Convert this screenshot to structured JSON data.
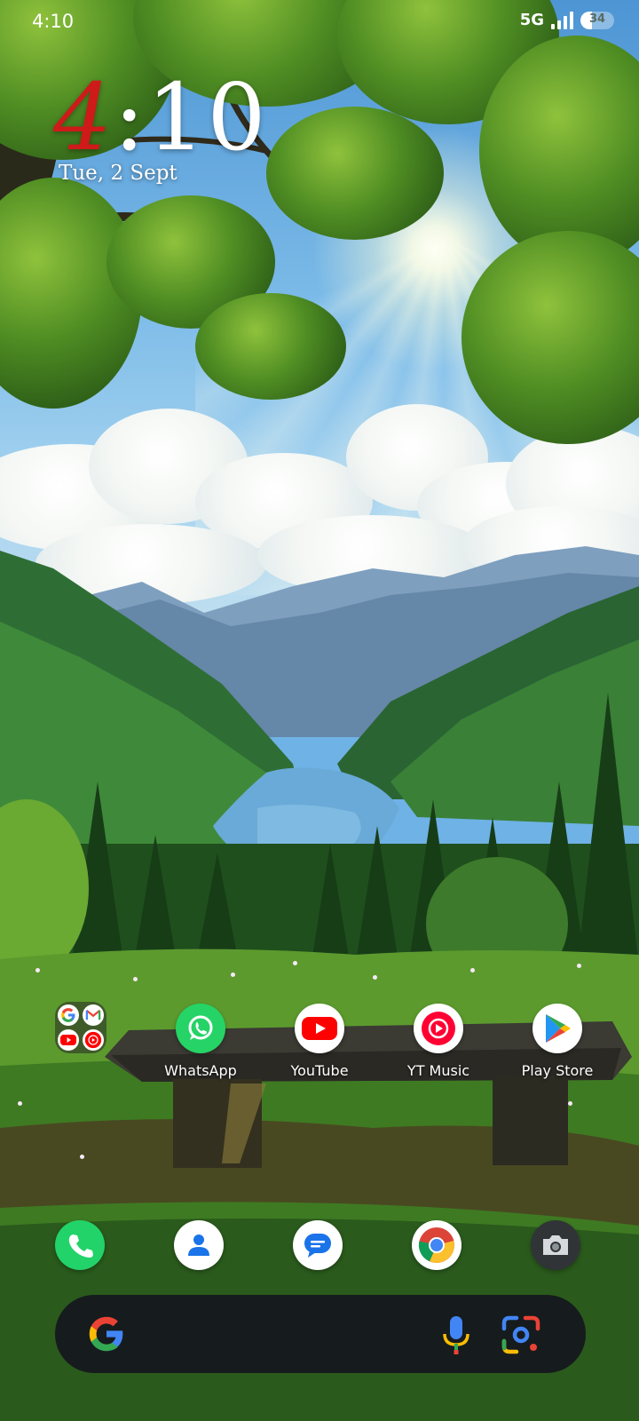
{
  "status_bar": {
    "time": "4:10",
    "network": "5G",
    "battery_text": "34",
    "battery_level": 0.34,
    "signal_icon": "signal-bars-icon"
  },
  "clock_widget": {
    "hour_first_digit": "4",
    "time_rest": ":10",
    "date": "Tue, 2 Sept"
  },
  "home_apps": [
    {
      "label": "WhatsApp",
      "icon": "whatsapp-icon"
    },
    {
      "label": "YouTube",
      "icon": "youtube-icon"
    },
    {
      "label": "YT Music",
      "icon": "yt-music-icon"
    },
    {
      "label": "Play Store",
      "icon": "play-store-icon"
    }
  ],
  "folder": {
    "apps": [
      "Google",
      "Gmail",
      "YouTube",
      "YT Music"
    ]
  },
  "dock": [
    {
      "icon": "phone-icon"
    },
    {
      "icon": "contacts-icon"
    },
    {
      "icon": "messages-icon"
    },
    {
      "icon": "chrome-icon"
    },
    {
      "icon": "camera-icon"
    }
  ],
  "search_bar": {
    "left_icon": "google-g-icon",
    "mic_icon": "mic-icon",
    "lens_icon": "google-lens-icon"
  },
  "colors": {
    "clock_accent": "#cf1a1a",
    "whatsapp": "#25d366",
    "youtube": "#ff0000",
    "search_bar_bg": "#161b1e"
  }
}
